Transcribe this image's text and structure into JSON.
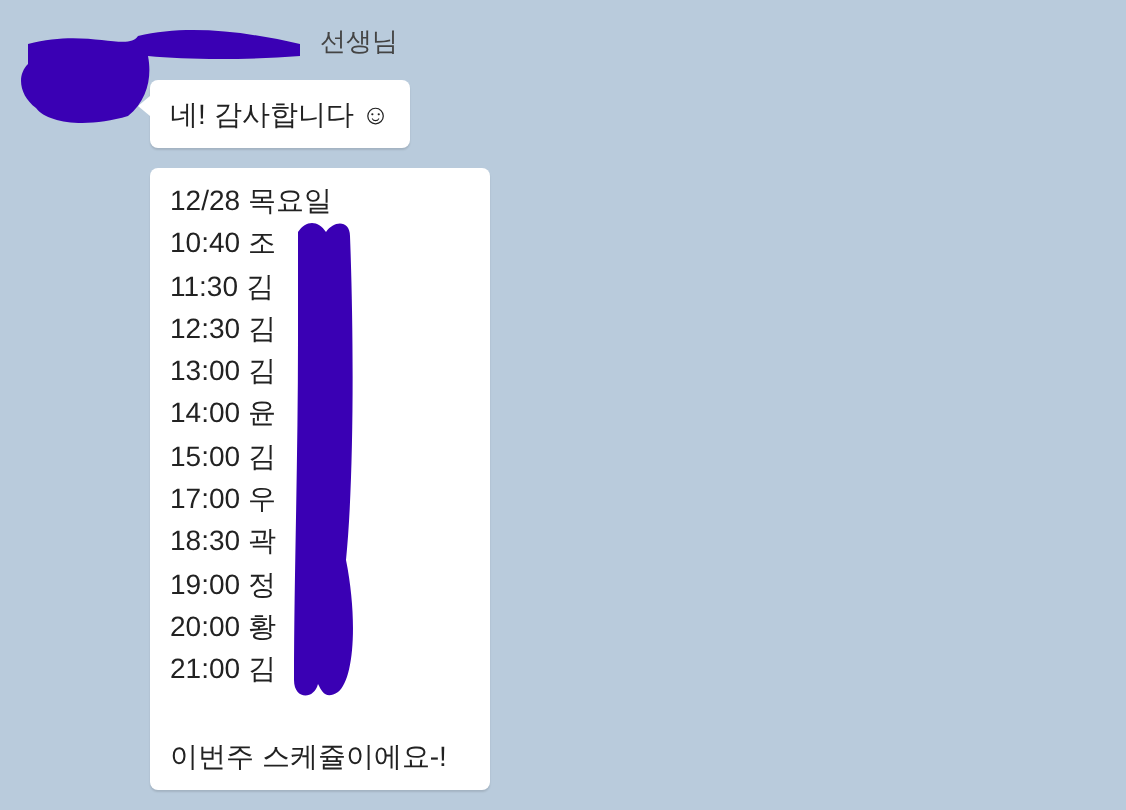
{
  "sender": {
    "name": "선생님"
  },
  "messages": [
    {
      "kind": "text",
      "text": "네! 감사합니다 ☺"
    },
    {
      "kind": "schedule",
      "lines": [
        "12/28 목요일",
        "10:40 조",
        "11:30 김",
        "12:30 김",
        "13:00 김",
        "14:00 윤",
        "15:00 김",
        "17:00 우",
        "18:30 곽",
        "19:00 정",
        "20:00 황",
        "21:00 김"
      ],
      "closing": "이번주 스케쥴이에요-!"
    }
  ]
}
